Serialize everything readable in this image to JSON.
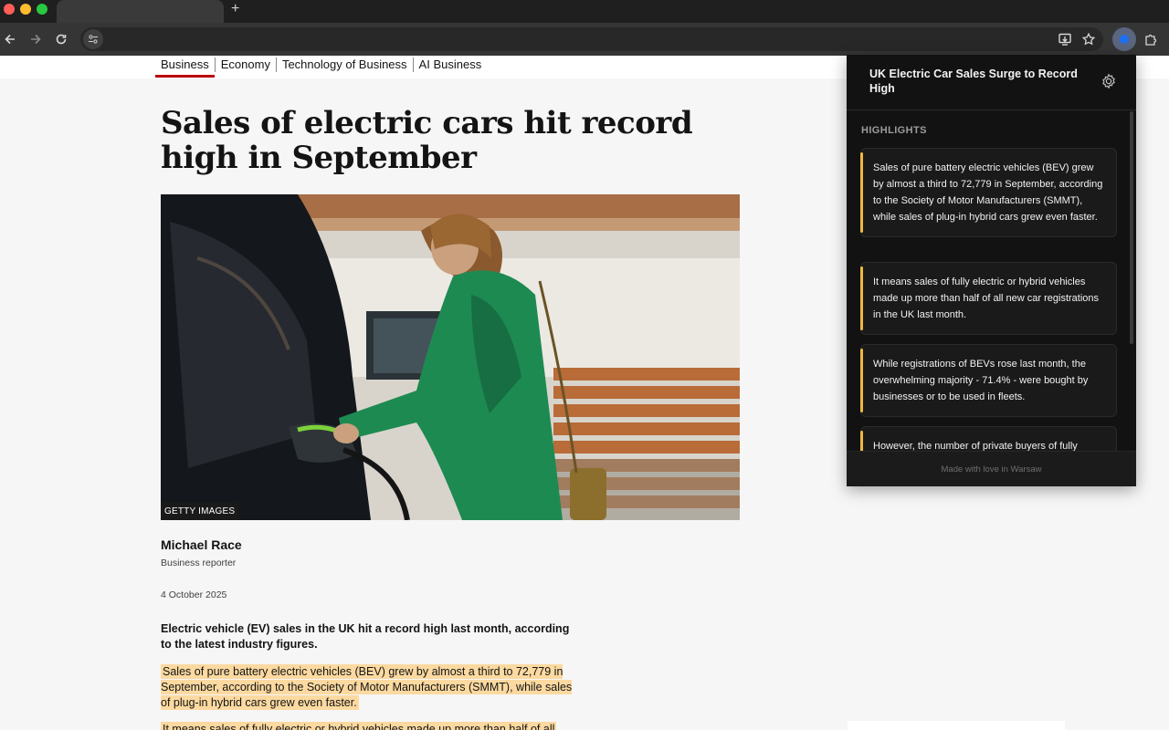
{
  "browser": {
    "new_tab_icon": "plus-icon",
    "back_icon": "arrow-left-icon",
    "forward_icon": "arrow-right-icon",
    "reload_icon": "reload-icon",
    "site_info_icon": "tune-icon",
    "install_icon": "install-app-icon",
    "bookmark_icon": "star-icon",
    "extension_icon": "extension-dot-icon",
    "extensions_menu_icon": "puzzle-icon",
    "accent_color": "#1f6ff2"
  },
  "subnav": {
    "items": [
      "Business",
      "Economy",
      "Technology of Business",
      "AI Business"
    ],
    "active": "Business",
    "active_color": "#b80000"
  },
  "article": {
    "headline": "Sales of electric cars hit record high in September",
    "image_credit": "GETTY IMAGES",
    "author": "Michael Race",
    "role": "Business reporter",
    "date": "4 October 2025",
    "lede": "Electric vehicle (EV) sales in the UK hit a record high last month, according to the latest industry figures.",
    "paragraphs": [
      "Sales of pure battery electric vehicles (BEV) grew by almost a third to 72,779 in September, according to the Society of Motor Manufacturers (SMMT), while sales of plug-in hybrid cars grew even faster.",
      "It means sales of fully electric or hybrid vehicles made up more than half of all"
    ],
    "highlight_color": "#fbd9a0"
  },
  "popup": {
    "title": "UK Electric Car Sales Surge to Record High",
    "settings_icon": "gear-icon",
    "highlights_label": "HIGHLIGHTS",
    "highlights": [
      "Sales of pure battery electric vehicles (BEV) grew by almost a third to 72,779 in September, according to the Society of Motor Manufacturers (SMMT), while sales of plug-in hybrid cars grew even faster.",
      "It means sales of fully electric or hybrid vehicles made up more than half of all new car registrations in the UK last month.",
      "While registrations of BEVs rose last month, the overwhelming majority - 71.4% - were bought by businesses or to be used in fleets.",
      "However, the number of private buyers of fully"
    ],
    "accent_color": "#f0b93e",
    "footer": "Made with love in Warsaw"
  }
}
